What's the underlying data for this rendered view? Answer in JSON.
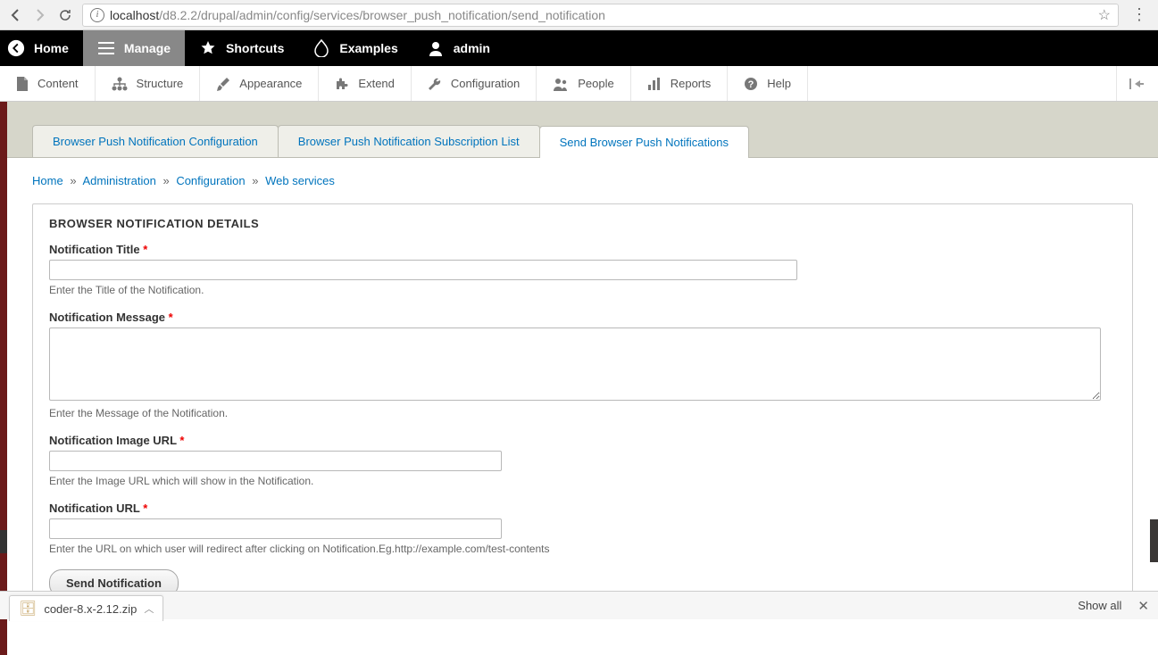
{
  "browser": {
    "url_host": "localhost",
    "url_path": "/d8.2.2/drupal/admin/config/services/browser_push_notification/send_notification"
  },
  "toolbar": {
    "home": "Home",
    "manage": "Manage",
    "shortcuts": "Shortcuts",
    "examples": "Examples",
    "user": "admin"
  },
  "admin_menu": {
    "content": "Content",
    "structure": "Structure",
    "appearance": "Appearance",
    "extend": "Extend",
    "configuration": "Configuration",
    "people": "People",
    "reports": "Reports",
    "help": "Help"
  },
  "tabs": [
    {
      "label": "Browser Push Notification Configuration",
      "active": false
    },
    {
      "label": "Browser Push Notification Subscription List",
      "active": false
    },
    {
      "label": "Send Browser Push Notifications",
      "active": true
    }
  ],
  "breadcrumb": {
    "home": "Home",
    "admin": "Administration",
    "config": "Configuration",
    "webservices": "Web services",
    "sep": "»"
  },
  "fieldset_legend": "BROWSER NOTIFICATION DETAILS",
  "form": {
    "title": {
      "label": "Notification Title",
      "value": "",
      "desc": "Enter the Title of the Notification."
    },
    "message": {
      "label": "Notification Message",
      "value": "",
      "desc": "Enter the Message of the Notification."
    },
    "image": {
      "label": "Notification Image URL",
      "value": "",
      "desc": "Enter the Image URL which will show in the Notification."
    },
    "url": {
      "label": "Notification URL",
      "value": "",
      "desc": "Enter the URL on which user will redirect after clicking on Notification.Eg.http://example.com/test-contents"
    },
    "submit": "Send Notification",
    "required": "*"
  },
  "download": {
    "filename": "coder-8.x-2.12.zip",
    "showall": "Show all"
  }
}
